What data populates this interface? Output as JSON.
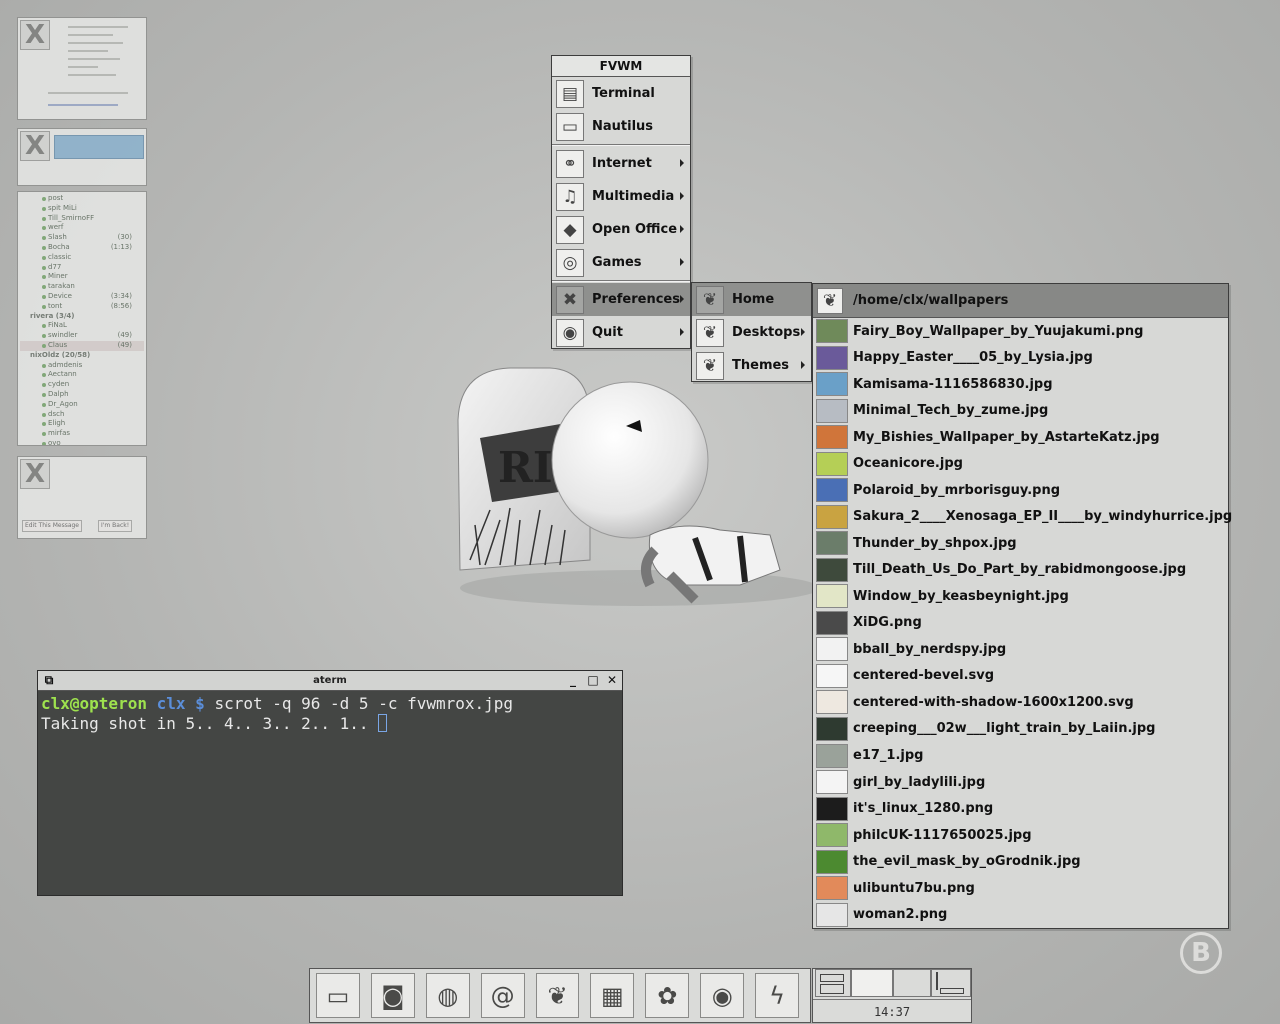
{
  "pager": {
    "ticket_buttons": {
      "edit": "Edit This Message",
      "back": "I'm Back!"
    },
    "contacts": [
      {
        "name": "post",
        "type": "contact"
      },
      {
        "name": "spit MiLi",
        "type": "contact"
      },
      {
        "name": "Till_SmirnoFF",
        "type": "contact"
      },
      {
        "name": "werf",
        "type": "contact"
      },
      {
        "name": "Slash",
        "count": "(30)",
        "type": "contact"
      },
      {
        "name": "Bocha",
        "count": "(1:13)",
        "type": "contact"
      },
      {
        "name": "classic",
        "type": "contact"
      },
      {
        "name": "d77",
        "type": "contact"
      },
      {
        "name": "Miner",
        "type": "contact"
      },
      {
        "name": "tarakan",
        "type": "contact"
      },
      {
        "name": "Device",
        "count": "(3:34)",
        "type": "contact"
      },
      {
        "name": "tont",
        "count": "(8:56)",
        "type": "contact"
      },
      {
        "name": "rivera (3/4)",
        "type": "group"
      },
      {
        "name": "FiNaL",
        "type": "contact"
      },
      {
        "name": "swindler",
        "count": "(49)",
        "type": "contact"
      },
      {
        "name": "Claus",
        "count": "(49)",
        "type": "contact",
        "highlight": true
      },
      {
        "name": "nixOldz (20/58)",
        "type": "group"
      },
      {
        "name": "admdenis",
        "type": "contact"
      },
      {
        "name": "Aectann",
        "type": "contact"
      },
      {
        "name": "cyden",
        "type": "contact"
      },
      {
        "name": "Dalph",
        "type": "contact"
      },
      {
        "name": "Dr_Agon",
        "type": "contact"
      },
      {
        "name": "dsch",
        "type": "contact"
      },
      {
        "name": "Eligh",
        "type": "contact"
      },
      {
        "name": "mirfas",
        "type": "contact"
      },
      {
        "name": "oyo",
        "type": "contact"
      }
    ]
  },
  "main_menu": {
    "title": "FVWM",
    "items": [
      {
        "label": "Terminal",
        "icon": "terminal-icon",
        "glyph": "▤",
        "submenu": false
      },
      {
        "label": "Nautilus",
        "icon": "file-manager-icon",
        "glyph": "▭",
        "submenu": false
      },
      {
        "label": "Internet",
        "icon": "internet-icon",
        "glyph": "⚭",
        "submenu": true
      },
      {
        "label": "Multimedia",
        "icon": "music-note-icon",
        "glyph": "♫",
        "submenu": true
      },
      {
        "label": "Open Office",
        "icon": "office-icon",
        "glyph": "◆",
        "submenu": true
      },
      {
        "label": "Games",
        "icon": "games-icon",
        "glyph": "◎",
        "submenu": true
      },
      {
        "label": "Preferences",
        "icon": "preferences-tools-icon",
        "glyph": "✖",
        "submenu": true,
        "active": true
      },
      {
        "label": "Quit",
        "icon": "quit-icon",
        "glyph": "◉",
        "submenu": true
      }
    ]
  },
  "prefs_menu": {
    "items": [
      {
        "label": "Home",
        "submenu": false,
        "active": true
      },
      {
        "label": "Desktops",
        "submenu": true
      },
      {
        "label": "Themes",
        "submenu": true
      }
    ]
  },
  "wallpapers_menu": {
    "title": "/home/clx/wallpapers",
    "items": [
      {
        "label": "Fairy_Boy_Wallpaper_by_Yuujakumi.png",
        "color": "#6f8a5a"
      },
      {
        "label": "Happy_Easter____05_by_Lysia.jpg",
        "color": "#6a5a9a"
      },
      {
        "label": "Kamisama-1116586830.jpg",
        "color": "#6aa0c8"
      },
      {
        "label": "Minimal_Tech_by_zume.jpg",
        "color": "#b7bcc3"
      },
      {
        "label": "My_Bishies_Wallpaper_by_AstarteKatz.jpg",
        "color": "#d0753a"
      },
      {
        "label": "Oceanicore.jpg",
        "color": "#b5cf56"
      },
      {
        "label": "Polaroid_by_mrborisguy.png",
        "color": "#4a6fb5"
      },
      {
        "label": "Sakura_2____Xenosaga_EP_II____by_windyhurrice.jpg",
        "color": "#c9a341"
      },
      {
        "label": "Thunder_by_shpox.jpg",
        "color": "#6b7d6a"
      },
      {
        "label": "Till_Death_Us_Do_Part_by_rabidmongoose.jpg",
        "color": "#3e4a3c"
      },
      {
        "label": "Window_by_keasbeynight.jpg",
        "color": "#e2e6c7"
      },
      {
        "label": "XiDG.png",
        "color": "#4a4a4a"
      },
      {
        "label": "bball_by_nerdspy.jpg",
        "color": "#f2f2f2"
      },
      {
        "label": "centered-bevel.svg",
        "color": "#f6f6f6"
      },
      {
        "label": "centered-with-shadow-1600x1200.svg",
        "color": "#eee8e0"
      },
      {
        "label": "creeping___02w___light_train_by_Laiin.jpg",
        "color": "#2e3a30"
      },
      {
        "label": "e17_1.jpg",
        "color": "#9aa29a"
      },
      {
        "label": "girl_by_ladylili.jpg",
        "color": "#f4f4f4"
      },
      {
        "label": "it's_linux_1280.png",
        "color": "#1c1c1c"
      },
      {
        "label": "philcUK-1117650025.jpg",
        "color": "#8fb86a"
      },
      {
        "label": "the_evil_mask_by_oGrodnik.jpg",
        "color": "#4c8a30"
      },
      {
        "label": "ulibuntu7bu.png",
        "color": "#e28a5a"
      },
      {
        "label": "woman2.png",
        "color": "#e6e6e6"
      }
    ]
  },
  "aterm": {
    "title": "aterm",
    "prompt_user": "clx@opteron",
    "prompt_dir": "clx",
    "prompt_sign": "$",
    "command": "scrot -q 96 -d 5 -c fvwmrox.jpg",
    "output": "Taking shot in 5.. 4.. 3.. 2.. 1.. "
  },
  "dock": {
    "launchers": [
      {
        "name": "new-file-icon",
        "glyph": "▭"
      },
      {
        "name": "camera-icon",
        "glyph": "◙"
      },
      {
        "name": "globe-icon",
        "glyph": "◍"
      },
      {
        "name": "email-at-icon",
        "glyph": "@"
      },
      {
        "name": "leaf-icon",
        "glyph": "❦"
      },
      {
        "name": "clapperboard-icon",
        "glyph": "▦"
      },
      {
        "name": "flower-icon",
        "glyph": "✿"
      },
      {
        "name": "disc-icon",
        "glyph": "◉"
      },
      {
        "name": "lightning-icon",
        "glyph": "ϟ"
      }
    ]
  },
  "clock": "14:37",
  "wallpaper": {
    "tombstone_text": "RIP"
  }
}
